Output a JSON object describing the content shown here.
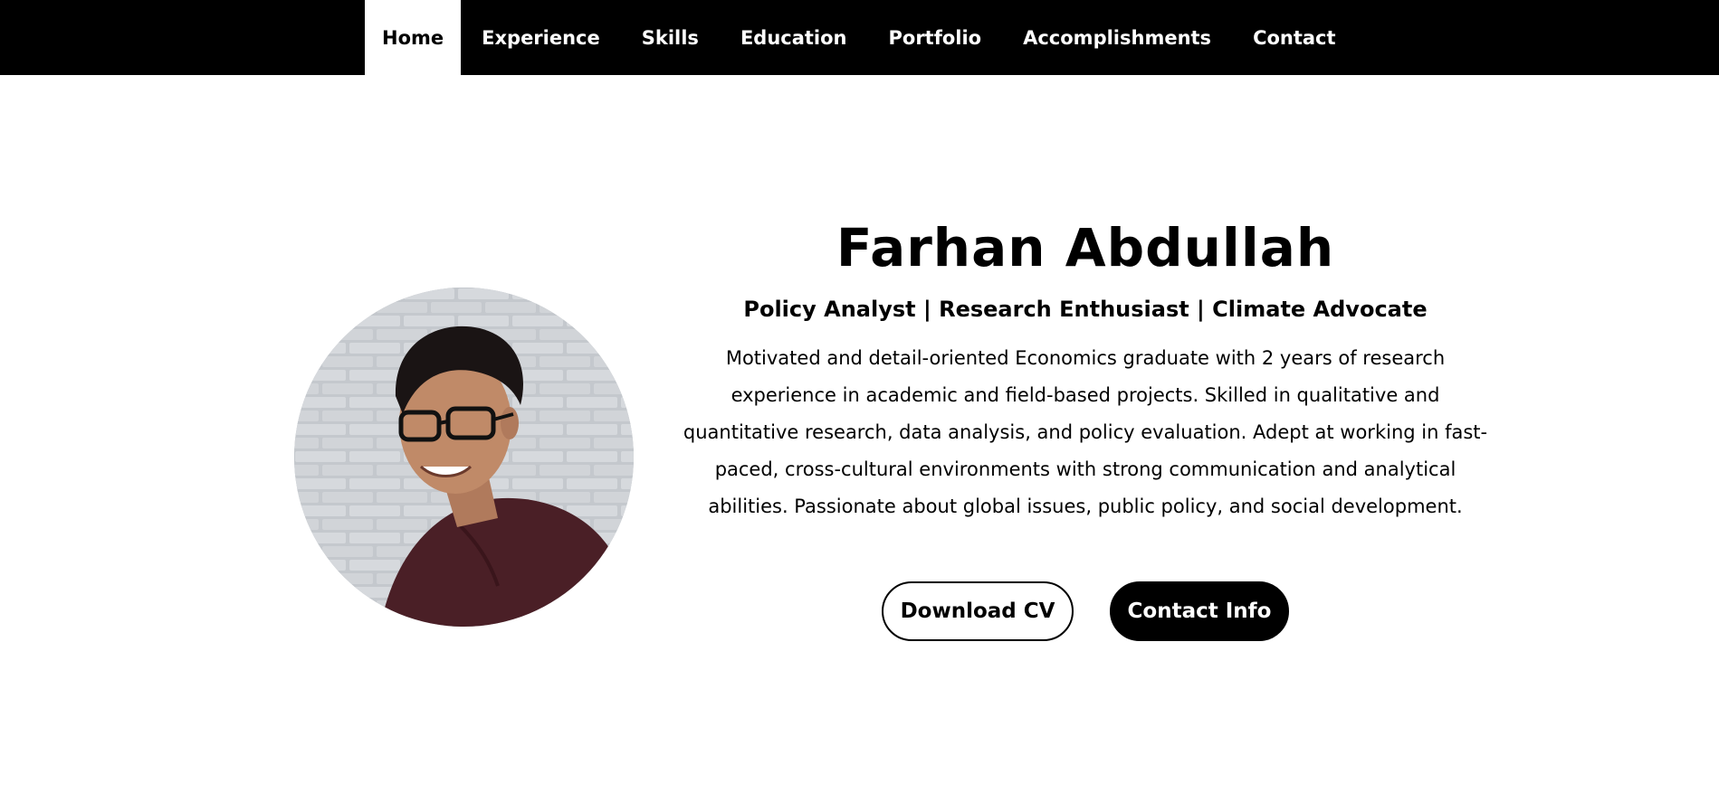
{
  "nav": {
    "items": [
      {
        "label": "Home",
        "active": true
      },
      {
        "label": "Experience",
        "active": false
      },
      {
        "label": "Skills",
        "active": false
      },
      {
        "label": "Education",
        "active": false
      },
      {
        "label": "Portfolio",
        "active": false
      },
      {
        "label": "Accomplishments",
        "active": false
      },
      {
        "label": "Contact",
        "active": false
      }
    ]
  },
  "hero": {
    "name": "Farhan Abdullah",
    "tagline": "Policy Analyst | Research Enthusiast | Climate Advocate",
    "bio": "Motivated and detail-oriented Economics graduate with 2 years of research experience in academic and field-based projects. Skilled in qualitative and quantitative research, data analysis, and policy evaluation. Adept at working in fast-paced, cross-cultural environments with strong communication and analytical abilities. Passionate about global issues, public policy, and social development.",
    "buttons": {
      "download_cv": "Download CV",
      "contact_info": "Contact Info"
    }
  },
  "colors": {
    "nav_bg": "#000000",
    "page_bg": "#ffffff",
    "primary_button_bg": "#000000"
  }
}
